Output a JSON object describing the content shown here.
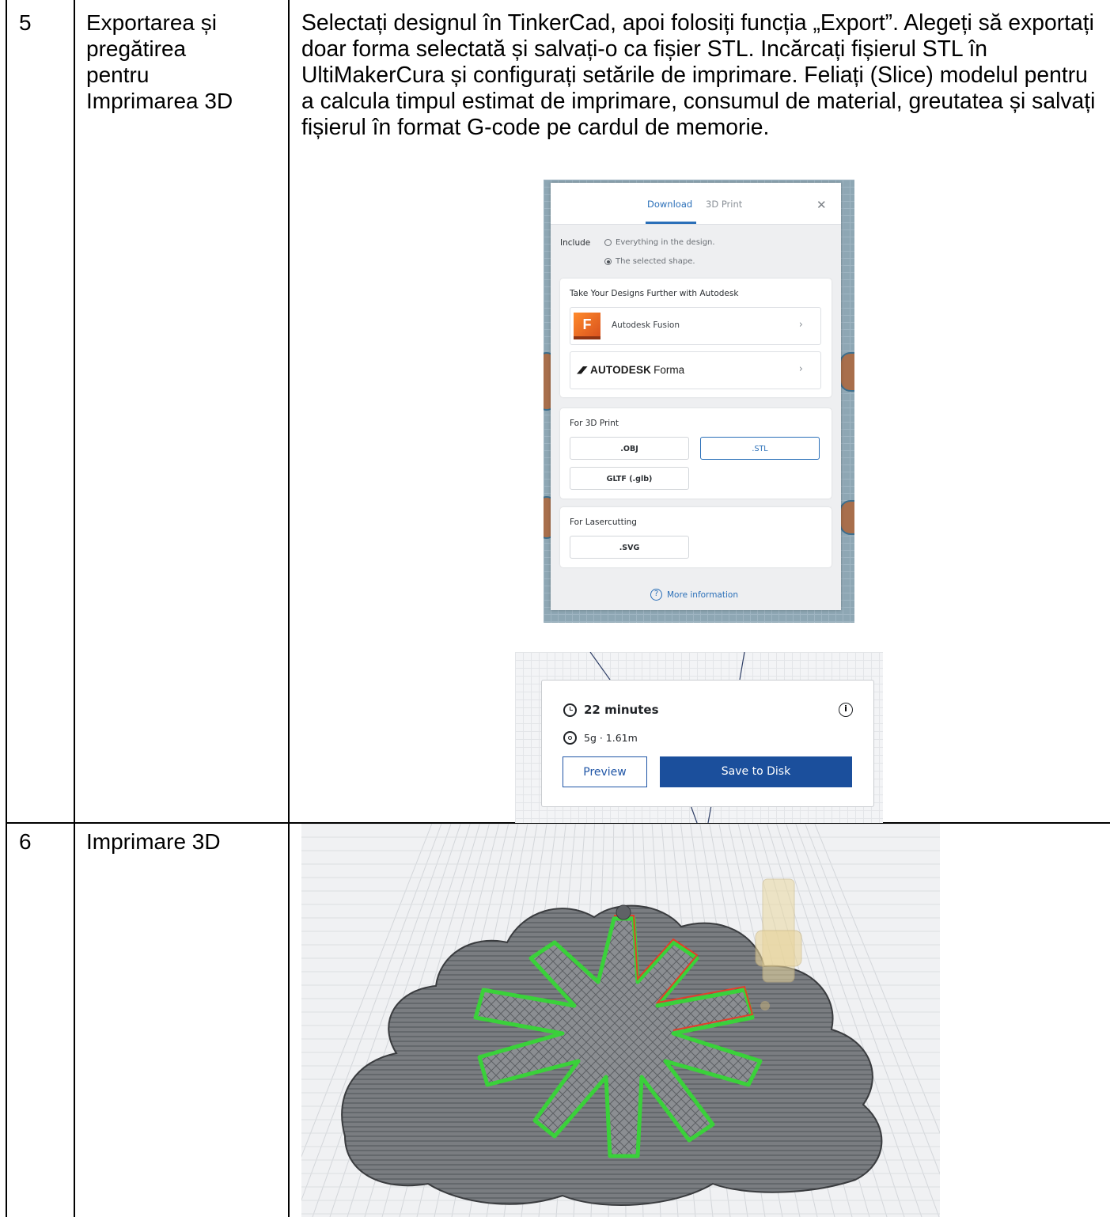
{
  "rows": [
    {
      "number": "5",
      "title_lines": [
        "Exportarea și",
        "pregătirea",
        "pentru",
        "Imprimarea 3D"
      ],
      "description": "Selectați designul în TinkerCad, apoi folosiți funcția „Export”. Alegeți să exportați doar forma selectată și salvați-o ca fișier STL. Incărcați fișierul STL în UltiMakerCura și configurați setările de imprimare. Feliați (Slice) modelul pentru a calcula timpul estimat de imprimare, consumul de material, greutatea și salvați fișierul în format G-code pe cardul de memorie."
    },
    {
      "number": "6",
      "title_lines": [
        "Imprimare 3D"
      ]
    }
  ],
  "export_dialog": {
    "tabs": [
      "Download",
      "3D Print"
    ],
    "active_tab": "Download",
    "close_icon": "close-icon",
    "include_label": "Include",
    "include_options": [
      {
        "label": "Everything in the design.",
        "selected": false
      },
      {
        "label": "The selected shape.",
        "selected": true
      }
    ],
    "autodesk_section": {
      "title": "Take Your Designs Further with Autodesk",
      "apps": [
        {
          "name": "Autodesk Fusion",
          "logo_letter": "F"
        },
        {
          "logo_bold": "AUTODESK",
          "logo_rest": "Forma"
        }
      ]
    },
    "print_section": {
      "title": "For 3D Print",
      "formats": [
        ".OBJ",
        ".STL",
        "GLTF (.glb)"
      ],
      "selected_format": ".STL"
    },
    "laser_section": {
      "title": "For Lasercutting",
      "formats": [
        ".SVG"
      ]
    },
    "more_info": "More information",
    "accent_color": "#2a6fb8"
  },
  "cura_result": {
    "time": "22 minutes",
    "material": "5g · 1.61m",
    "info_glyph": "i",
    "preview_label": "Preview",
    "save_label": "Save to Disk",
    "save_color": "#1b4f9c"
  },
  "render": {
    "subject": "snowflake",
    "path_colors": [
      "#3ad13a",
      "#e0402a"
    ],
    "body_color": "#777a7e"
  }
}
